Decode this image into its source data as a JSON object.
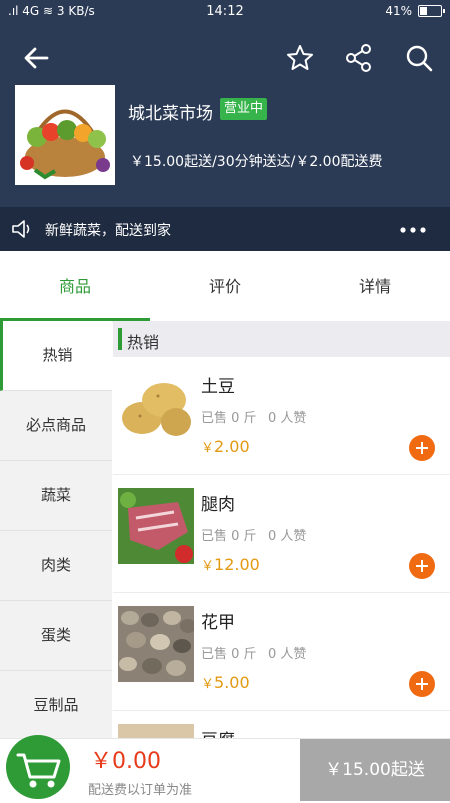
{
  "status_bar": {
    "network": "3 KB/s",
    "signal": "4G",
    "time": "14:12",
    "battery": "41%"
  },
  "store": {
    "name": "城北菜市场",
    "status_badge": "营业中",
    "delivery_info": "￥15.00起送/30分钟送达/￥2.00配送费",
    "notice": "新鲜蔬菜，配送到家"
  },
  "tabs": [
    {
      "label": "商品",
      "active": true
    },
    {
      "label": "评价",
      "active": false
    },
    {
      "label": "详情",
      "active": false
    }
  ],
  "categories": [
    {
      "label": "热销",
      "active": true
    },
    {
      "label": "必点商品",
      "active": false
    },
    {
      "label": "蔬菜",
      "active": false
    },
    {
      "label": "肉类",
      "active": false
    },
    {
      "label": "蛋类",
      "active": false
    },
    {
      "label": "豆制品",
      "active": false
    }
  ],
  "section_title": "热销",
  "products": [
    {
      "name": "土豆",
      "sold": "已售 0 斤",
      "likes": "0 人赞",
      "currency": "￥",
      "price": "2.00"
    },
    {
      "name": "腿肉",
      "sold": "已售 0 斤",
      "likes": "0 人赞",
      "currency": "￥",
      "price": "12.00"
    },
    {
      "name": "花甲",
      "sold": "已售 0 斤",
      "likes": "0 人赞",
      "currency": "￥",
      "price": "5.00"
    },
    {
      "name": "豆腐"
    }
  ],
  "cart": {
    "total": "￥0.00",
    "note": "配送费以订单为准",
    "checkout_label": "￥15.00起送"
  },
  "colors": {
    "header_bg": "#2b3a55",
    "accent_green": "#2e9b36",
    "price_orange": "#e39a13",
    "add_button": "#f06a12",
    "cart_total_red": "#e63a1a"
  },
  "icons": [
    "back-arrow-icon",
    "star-icon",
    "share-icon",
    "search-icon",
    "speaker-icon",
    "more-icon",
    "shopping-cart-icon",
    "plus-icon"
  ]
}
